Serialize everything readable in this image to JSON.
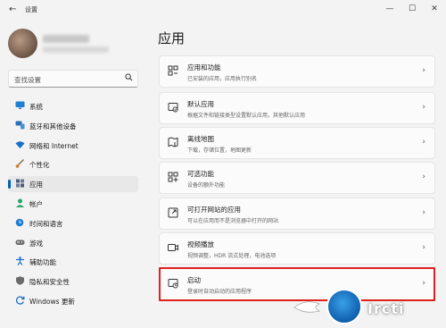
{
  "window": {
    "title": "设置",
    "back_glyph": "←",
    "minimize_glyph": "—",
    "maximize_glyph": "☐",
    "close_glyph": "✕"
  },
  "search": {
    "placeholder": "查找设置",
    "icon": "search-icon"
  },
  "sidebar": {
    "items": [
      {
        "label": "系统",
        "icon": "monitor-icon",
        "color": "#1f7fd4",
        "active": false
      },
      {
        "label": "蓝牙和其他设备",
        "icon": "bluetooth-devices-icon",
        "color": "#2b6fb8",
        "active": false
      },
      {
        "label": "网络和 Internet",
        "icon": "wifi-icon",
        "color": "#1c6fc9",
        "active": false
      },
      {
        "label": "个性化",
        "icon": "brush-icon",
        "color": "#d27a2c",
        "active": false
      },
      {
        "label": "应用",
        "icon": "apps-icon",
        "color": "#4a5a78",
        "active": true
      },
      {
        "label": "帐户",
        "icon": "account-icon",
        "color": "#2aa66a",
        "active": false
      },
      {
        "label": "时间和语言",
        "icon": "globe-clock-icon",
        "color": "#1c7bd4",
        "active": false
      },
      {
        "label": "游戏",
        "icon": "gamepad-icon",
        "color": "#6b6b6b",
        "active": false
      },
      {
        "label": "辅助功能",
        "icon": "accessibility-icon",
        "color": "#1c6fc9",
        "active": false
      },
      {
        "label": "隐私和安全性",
        "icon": "shield-icon",
        "color": "#6a6a6a",
        "active": false
      },
      {
        "label": "Windows 更新",
        "icon": "update-icon",
        "color": "#1c6fc9",
        "active": false
      }
    ]
  },
  "main": {
    "title": "应用",
    "cards": [
      {
        "title": "应用和功能",
        "desc": "已安装的应用，应用执行别名",
        "icon": "apps-features-icon"
      },
      {
        "title": "默认应用",
        "desc": "根据文件和链接类型设置默认应用，其他默认应用",
        "icon": "default-apps-icon"
      },
      {
        "title": "离线地图",
        "desc": "下载，存储位置，地图更新",
        "icon": "map-icon"
      },
      {
        "title": "可选功能",
        "desc": "设备的额外功能",
        "icon": "optional-features-icon"
      },
      {
        "title": "可打开网站的应用",
        "desc": "可以在应用而不是浏览器中打开的网站",
        "icon": "open-web-icon"
      },
      {
        "title": "视频播放",
        "desc": "视频调整，HDR 流式处理，电池选项",
        "icon": "video-icon"
      },
      {
        "title": "启动",
        "desc": "登录时自动启动的应用程序",
        "icon": "startup-icon",
        "highlighted": true
      }
    ]
  },
  "watermark": {
    "text": "Ircti"
  },
  "accent": "#005fb8",
  "highlight_color": "#e02020"
}
